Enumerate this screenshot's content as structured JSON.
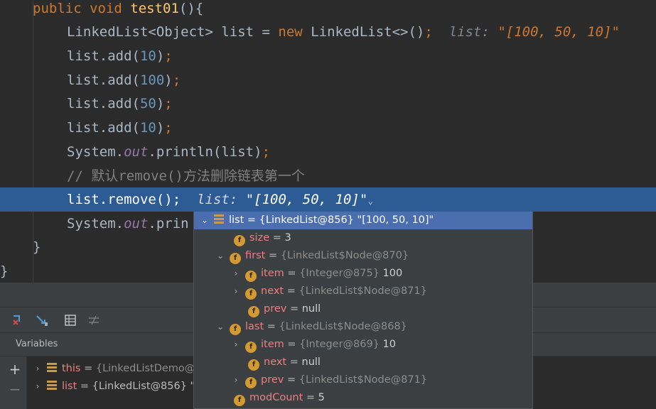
{
  "code": {
    "line1": {
      "kw": "public void ",
      "method": "test01",
      "rest": "(){"
    },
    "line2": {
      "type": "LinkedList<Object> list = ",
      "kw": "new",
      "ctor": " LinkedList<>()",
      "semi": ";",
      "hint_name": "list:",
      "hint_value": "\"[100, 50, 10]\""
    },
    "line3": {
      "pre": "list.add(",
      "num": "10",
      "post": ")",
      "semi": ";"
    },
    "line4": {
      "pre": "list.add(",
      "num": "100",
      "post": ")",
      "semi": ";"
    },
    "line5": {
      "pre": "list.add(",
      "num": "50",
      "post": ")",
      "semi": ";"
    },
    "line6": {
      "pre": "list.add(",
      "num": "10",
      "post": ")",
      "semi": ";"
    },
    "line7": {
      "pre": "System.",
      "stat": "out",
      "post": ".println(list)",
      "semi": ";"
    },
    "line8": {
      "comment": "// 默认remove()方法删除链表第一个"
    },
    "line9": {
      "code": "list.remove()",
      "semi": ";",
      "hint_name": "list:",
      "hint_value": "\"[100, 50, 10]\"",
      "hint_chevron": "⌄"
    },
    "line10": {
      "pre": "System.",
      "stat": "out",
      "post": ".prin"
    },
    "line11": {
      "brace": "}"
    },
    "line12": {
      "brace": "}"
    }
  },
  "debugger": {
    "toolbar_icons": [
      "step-into-icon",
      "force-step-icon",
      "table-icon",
      "evaluate-icon"
    ],
    "variables_label": "Variables",
    "side_add": "+",
    "side_remove": "−",
    "vars": [
      {
        "name": "this",
        "eq": " = ",
        "ref": "{LinkedListDemo@"
      },
      {
        "name": "list",
        "eq": " = ",
        "ref": "{LinkedList@856} \"["
      }
    ]
  },
  "popup": {
    "root": {
      "name": "list",
      "eq": " = ",
      "val": "{LinkedList@856} \"[100, 50, 10]\""
    },
    "rows": [
      {
        "name": "size",
        "eq": " = ",
        "val": "3"
      },
      {
        "name": "first",
        "eq": " = ",
        "ref": "{LinkedList$Node@870}"
      },
      {
        "name": "item",
        "eq": " = ",
        "ref": "{Integer@875} ",
        "val": "100"
      },
      {
        "name": "next",
        "eq": " = ",
        "ref": "{LinkedList$Node@871}"
      },
      {
        "name": "prev",
        "eq": " = ",
        "val": "null"
      },
      {
        "name": "last",
        "eq": " = ",
        "ref": "{LinkedList$Node@868}"
      },
      {
        "name": "item",
        "eq": " = ",
        "ref": "{Integer@869} ",
        "val": "10"
      },
      {
        "name": "next",
        "eq": " = ",
        "val": "null"
      },
      {
        "name": "prev",
        "eq": " = ",
        "ref": "{LinkedList$Node@871}"
      },
      {
        "name": "modCount",
        "eq": " = ",
        "val": "5"
      }
    ],
    "field_icon": "f",
    "expand_open": "⌄",
    "expand_closed": "›"
  }
}
